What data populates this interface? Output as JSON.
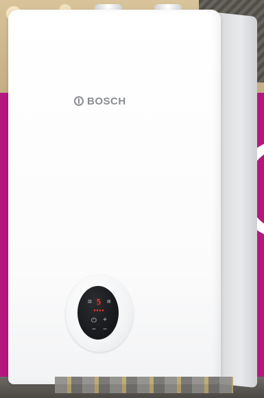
{
  "brand": {
    "name": "BOSCH"
  },
  "display": {
    "reading": "5"
  },
  "controls": {
    "power_symbol": "⏻",
    "plus_symbol": "+",
    "minus_symbol": "−"
  },
  "icons": {
    "logo": "bosch-armature-icon",
    "power": "power-icon",
    "plus": "plus-icon",
    "minus": "minus-icon",
    "tap": "tap-icon",
    "radiator": "radiator-icon"
  },
  "colors": {
    "magenta": "#b5177f",
    "boiler_white": "#ffffff",
    "logo_grey": "#8a8c90",
    "panel_black": "#17181b",
    "display_red": "#ff3b30"
  }
}
